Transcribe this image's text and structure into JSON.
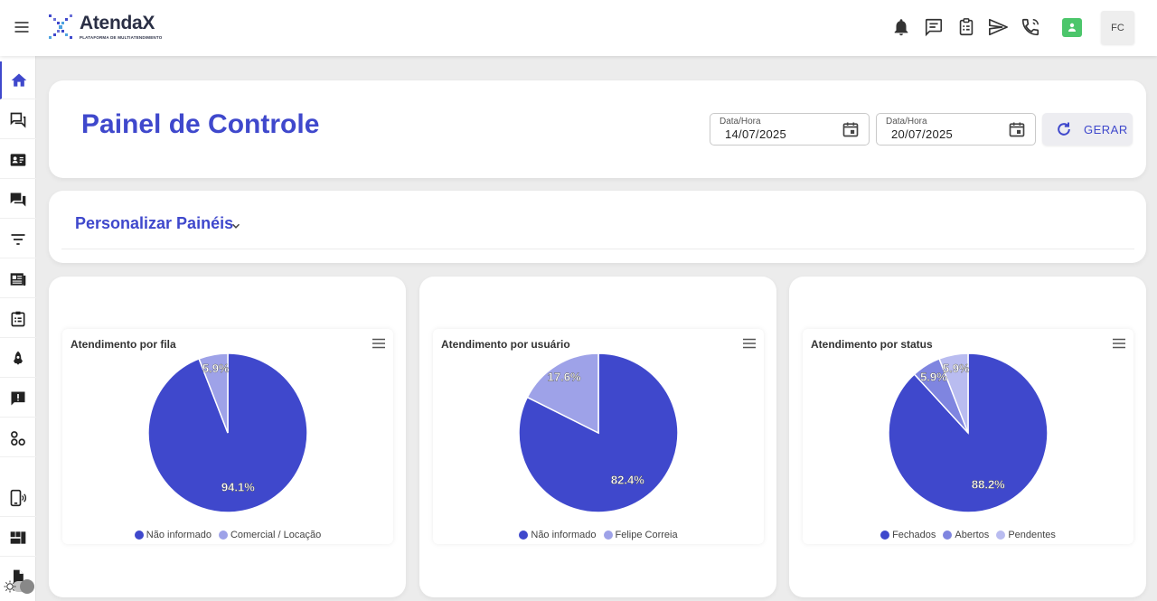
{
  "header": {
    "brand": "AtendaX",
    "brand_subtitle": "PLATAFORMA DE MULTIATENDIMENTO",
    "icons": [
      "menu-icon",
      "bell-icon",
      "chat-icon",
      "clipboard-icon",
      "send-icon",
      "phone-icon"
    ],
    "user_initials": "FC"
  },
  "sidebar": {
    "items": [
      "home-icon",
      "forum-icon",
      "contact-card-icon",
      "question-answer-icon",
      "filter-list-icon",
      "newspaper-icon",
      "clipboard-list-icon",
      "rocket-icon",
      "feedback-icon",
      "workflow-icon",
      "phone-android-icon",
      "dashboard-icon",
      "file-icon"
    ]
  },
  "controls": {
    "title": "Painel de Controle",
    "start": {
      "label": "Data/Hora",
      "value": "14/07/2025"
    },
    "end": {
      "label": "Data/Hora",
      "value": "20/07/2025"
    },
    "generate_label": "GERAR"
  },
  "customize": {
    "label": "Personalizar Painéis"
  },
  "colors": {
    "primary": "#3f48cc",
    "slice_mid": "#8f95e6",
    "slice_light": "#b9bcf0"
  },
  "chart_data": [
    {
      "type": "pie",
      "title": "Atendimento por fila",
      "categories": [
        "Não informado",
        "Comercial / Locação"
      ],
      "values": [
        94.1,
        5.9
      ],
      "labels": [
        "94.1%",
        "5.9%"
      ],
      "colors": [
        "#3f48cc",
        "#9ea2e8"
      ]
    },
    {
      "type": "pie",
      "title": "Atendimento por usuário",
      "categories": [
        "Não informado",
        "Felipe Correia"
      ],
      "values": [
        82.4,
        17.6
      ],
      "labels": [
        "82.4%",
        "17.6%"
      ],
      "colors": [
        "#3f48cc",
        "#9ea2e8"
      ]
    },
    {
      "type": "pie",
      "title": "Atendimento por status",
      "categories": [
        "Fechados",
        "Abertos",
        "Pendentes"
      ],
      "values": [
        88.2,
        5.9,
        5.9
      ],
      "labels": [
        "88.2%",
        "5.9%",
        "5.9%"
      ],
      "colors": [
        "#3f48cc",
        "#7f85e0",
        "#b9bcf0"
      ]
    }
  ]
}
